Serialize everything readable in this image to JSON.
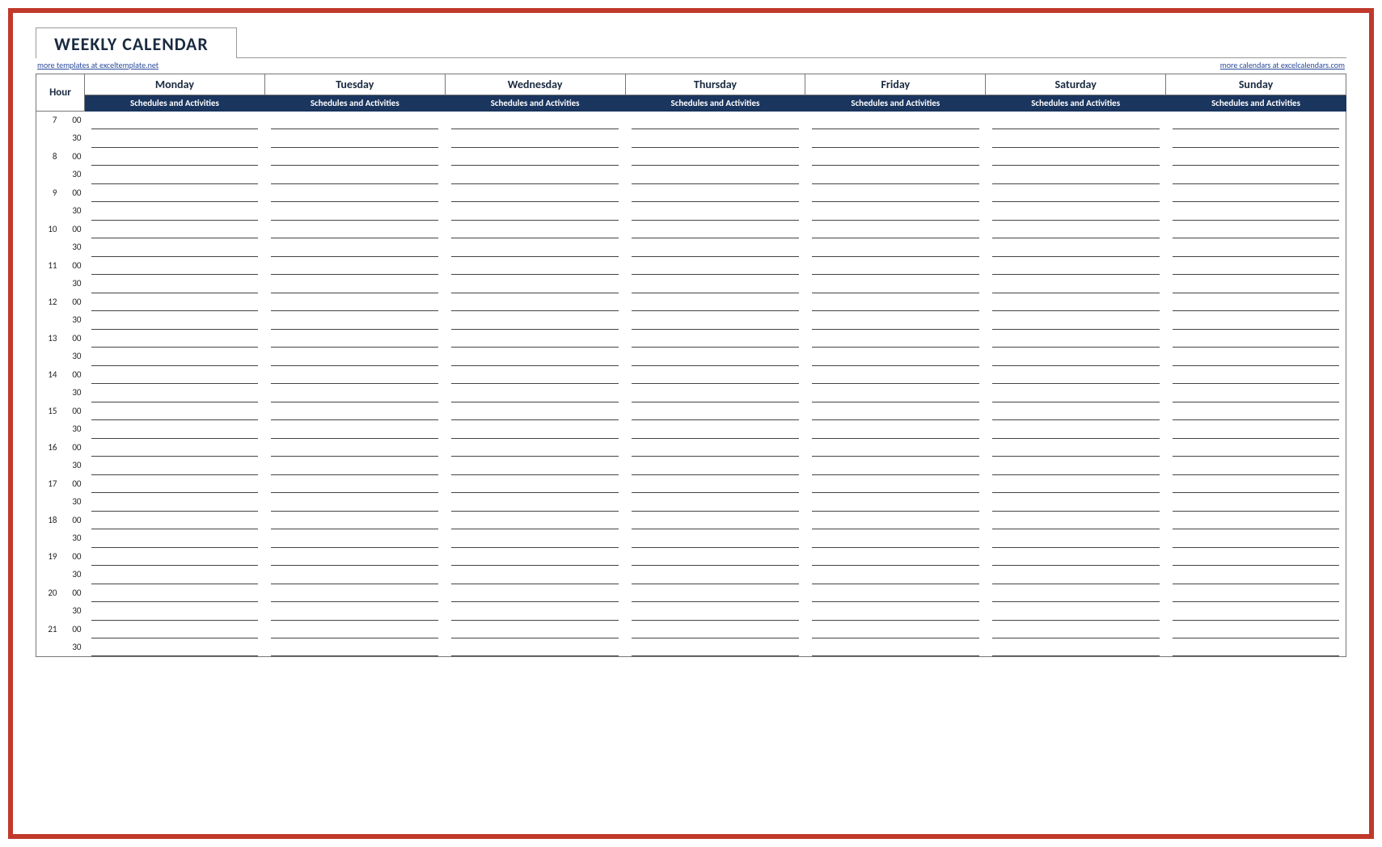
{
  "title": "WEEKLY CALENDAR",
  "links": {
    "left": "more templates at exceltemplate.net",
    "right": "more calendars at excelcalendars.com"
  },
  "hour_header": "Hour",
  "subheader": "Schedules and Activities",
  "days": [
    "Monday",
    "Tuesday",
    "Wednesday",
    "Thursday",
    "Friday",
    "Saturday",
    "Sunday"
  ],
  "rows": [
    {
      "h": "7",
      "m": "00"
    },
    {
      "h": "",
      "m": "30"
    },
    {
      "h": "8",
      "m": "00"
    },
    {
      "h": "",
      "m": "30"
    },
    {
      "h": "9",
      "m": "00"
    },
    {
      "h": "",
      "m": "30"
    },
    {
      "h": "10",
      "m": "00"
    },
    {
      "h": "",
      "m": "30"
    },
    {
      "h": "11",
      "m": "00"
    },
    {
      "h": "",
      "m": "30"
    },
    {
      "h": "12",
      "m": "00"
    },
    {
      "h": "",
      "m": "30"
    },
    {
      "h": "13",
      "m": "00"
    },
    {
      "h": "",
      "m": "30"
    },
    {
      "h": "14",
      "m": "00"
    },
    {
      "h": "",
      "m": "30"
    },
    {
      "h": "15",
      "m": "00"
    },
    {
      "h": "",
      "m": "30"
    },
    {
      "h": "16",
      "m": "00"
    },
    {
      "h": "",
      "m": "30"
    },
    {
      "h": "17",
      "m": "00"
    },
    {
      "h": "",
      "m": "30"
    },
    {
      "h": "18",
      "m": "00"
    },
    {
      "h": "",
      "m": "30"
    },
    {
      "h": "19",
      "m": "00"
    },
    {
      "h": "",
      "m": "30"
    },
    {
      "h": "20",
      "m": "00"
    },
    {
      "h": "",
      "m": "30"
    },
    {
      "h": "21",
      "m": "00"
    },
    {
      "h": "",
      "m": "30"
    }
  ]
}
